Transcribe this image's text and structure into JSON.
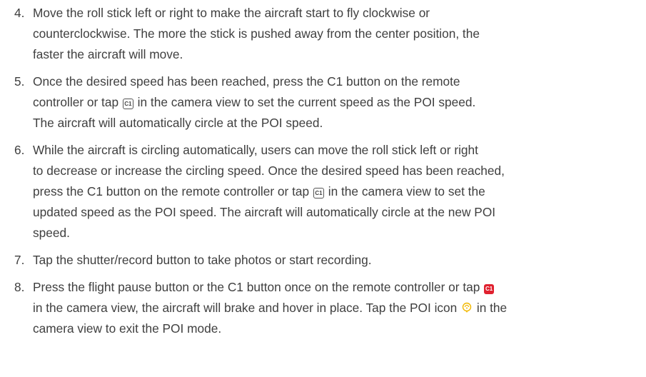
{
  "steps": [
    {
      "number": "4.",
      "lines": [
        "Move the roll stick left or right to make the aircraft start to fly clockwise or",
        "counterclockwise. The more the stick is pushed away from the center position, the",
        "faster the aircraft will move."
      ]
    },
    {
      "number": "5.",
      "line1": "Once the desired speed has been reached, press the C1 button on the remote",
      "line2_before": "controller or tap ",
      "line2_after": " in the camera view to set the current speed as the POI speed.",
      "line3": "The aircraft will automatically circle at the POI speed."
    },
    {
      "number": "6.",
      "line1": "While the aircraft is circling automatically, users can move the roll stick left or right",
      "line2": "to decrease or increase the circling speed. Once the desired speed has been reached,",
      "line3_before": "press the C1 button on the remote controller or tap ",
      "line3_after": " in the camera view to set the",
      "line4": "updated speed as the POI speed. The aircraft will automatically circle at the new POI",
      "line5": "speed."
    },
    {
      "number": "7.",
      "line1": "Tap the shutter/record button to take photos or start recording."
    },
    {
      "number": "8.",
      "line1_before": "Press the flight pause button or the C1 button once on the remote controller or tap ",
      "line2_before": "in the camera view, the aircraft will brake and hover in place. Tap the POI icon ",
      "line2_after": " in the",
      "line3": "camera view to exit the POI mode."
    }
  ],
  "icons": {
    "c1_label": "C1",
    "c1_outline_color": "#555555",
    "c1_red_color": "#e0212f",
    "poi_color": "#f2b800"
  }
}
